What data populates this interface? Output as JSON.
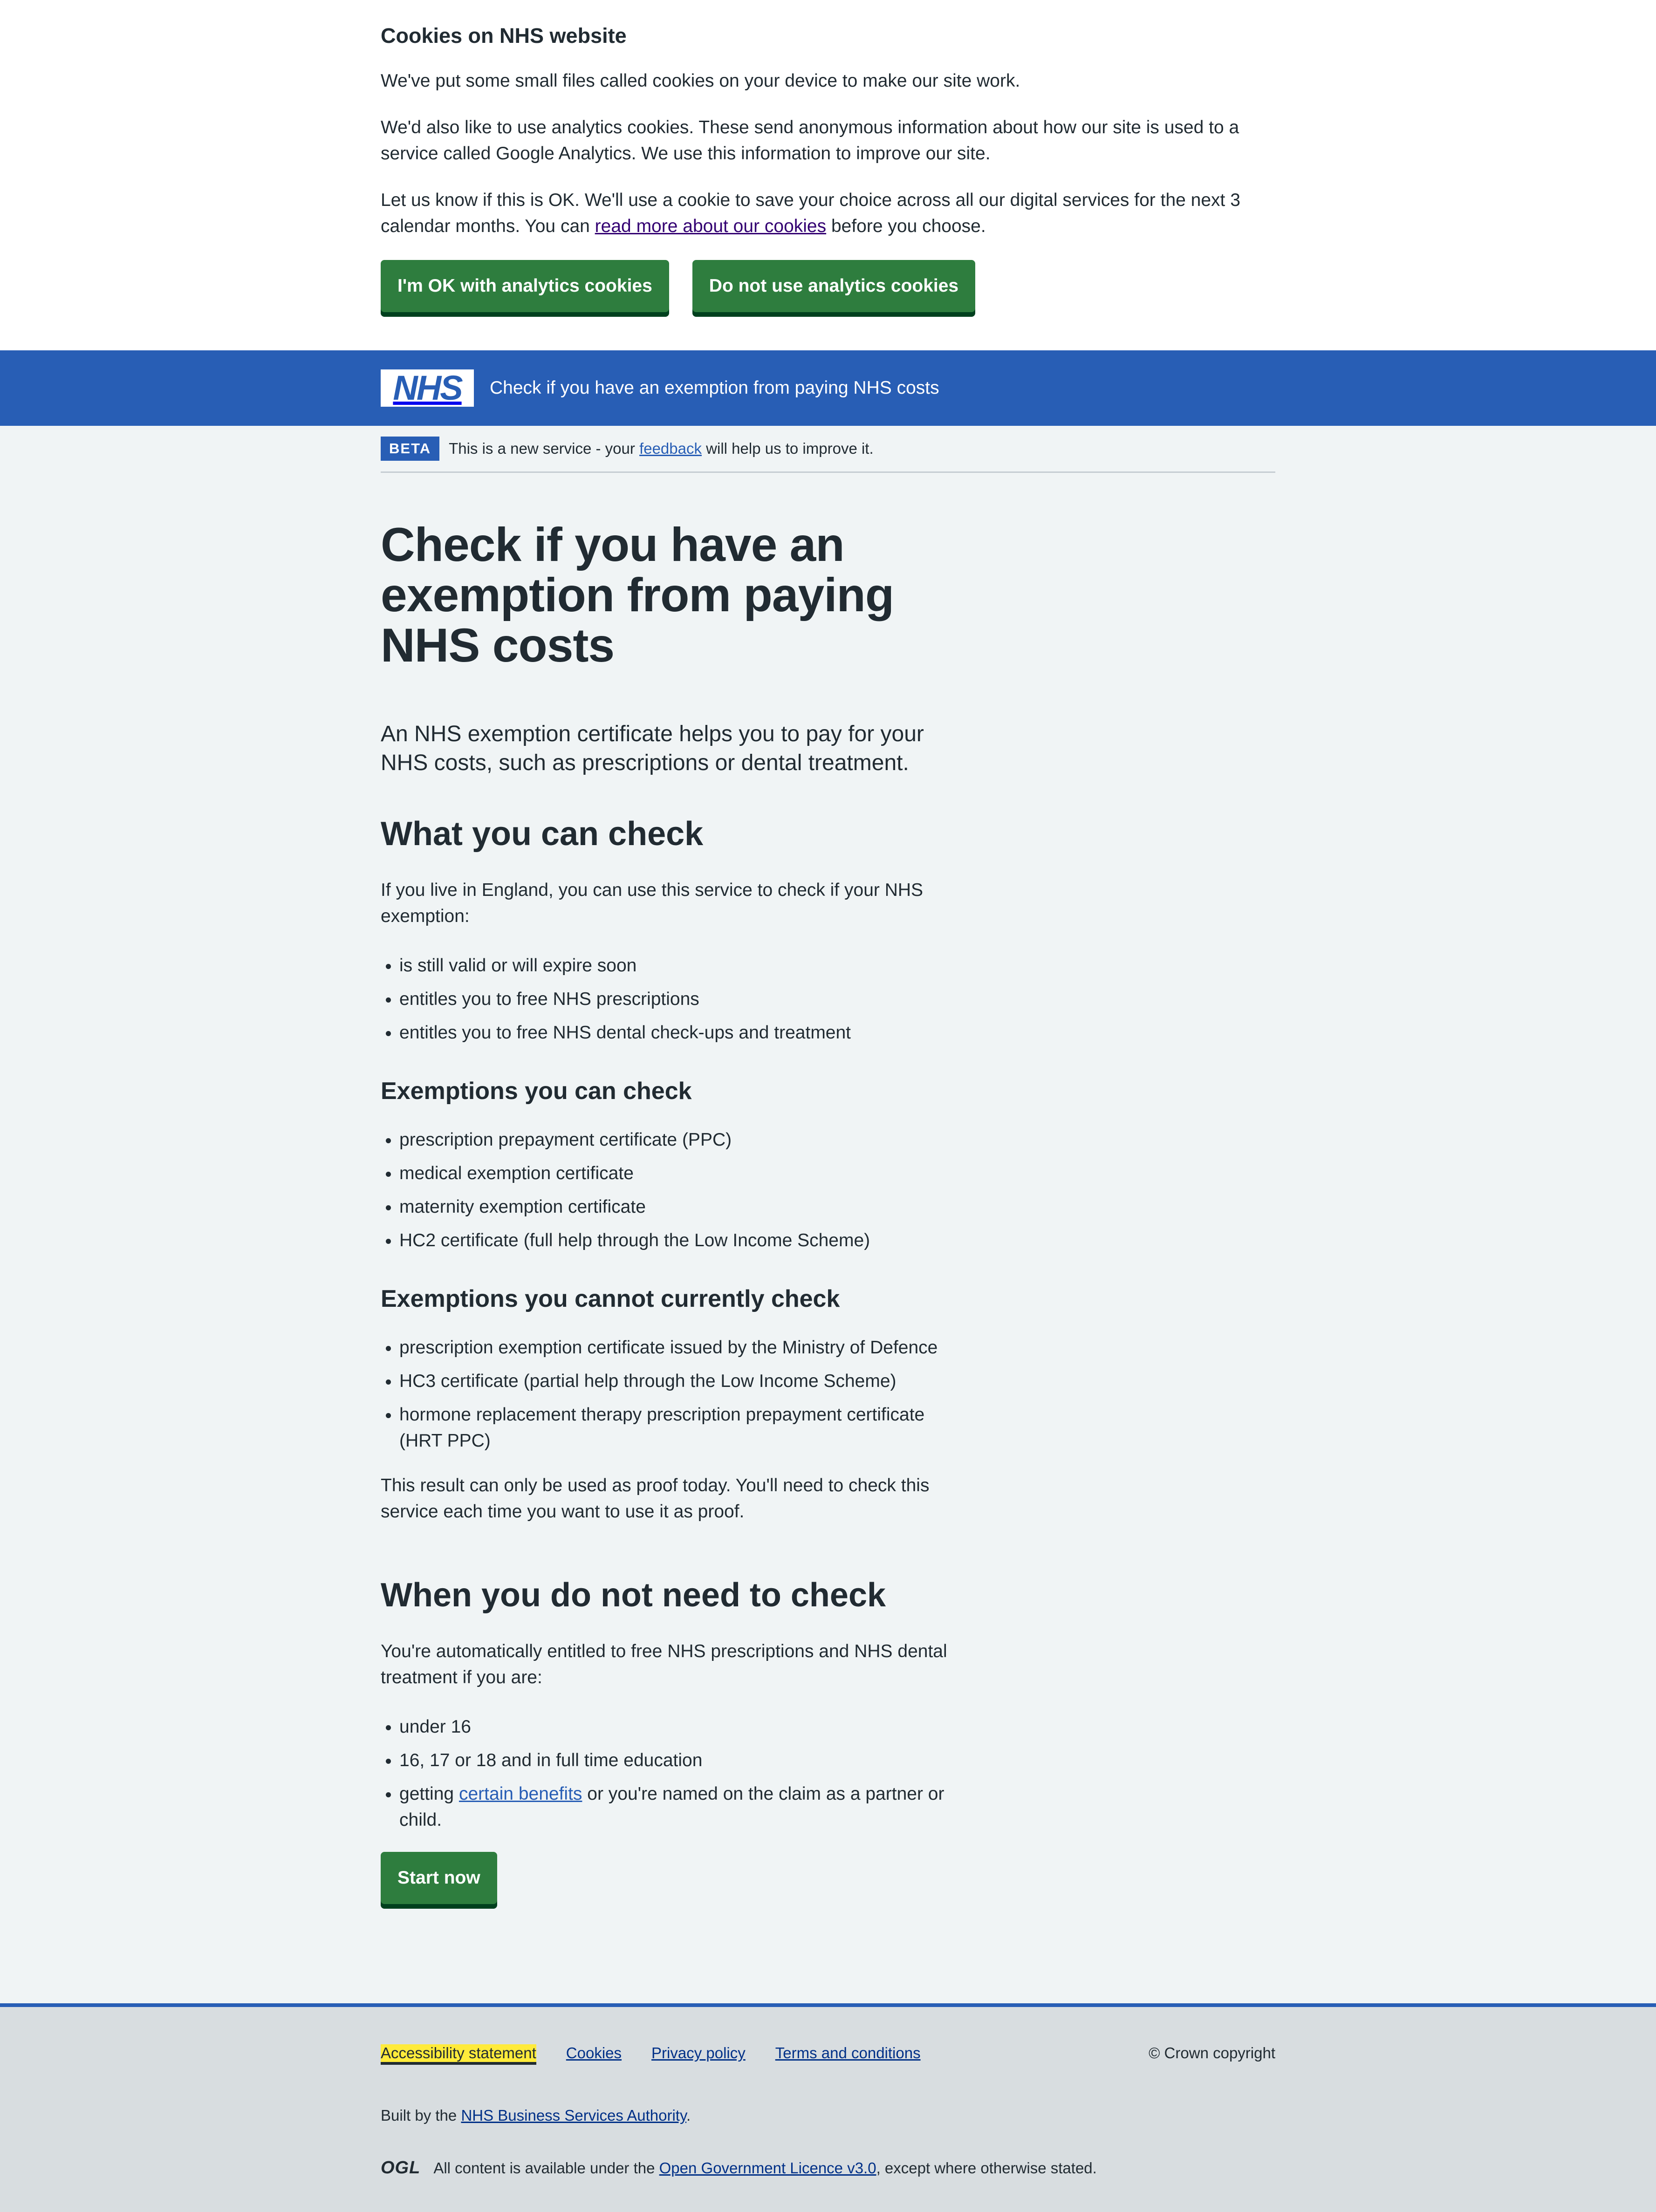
{
  "cookie_banner": {
    "title": "Cookies on NHS website",
    "p1": "We've put some small files called cookies on your device to make our site work.",
    "p2": "We'd also like to use analytics cookies. These send anonymous information about how our site is used to a service called Google Analytics. We use this information to improve our site.",
    "p3_before": "Let us know if this is OK. We'll use a cookie to save your choice across all our digital services for the next 3 calendar months. You can ",
    "p3_link": "read more about our cookies",
    "p3_after": " before you choose.",
    "accept_label": "I'm OK with analytics cookies",
    "reject_label": "Do not use analytics cookies"
  },
  "header": {
    "logo_text": "NHS",
    "service_name": "Check if you have an exemption from paying NHS costs"
  },
  "phase_banner": {
    "tag": "BETA",
    "text_before": "This is a new service - your ",
    "link": "feedback",
    "text_after": " will help us to improve it."
  },
  "main": {
    "title": "Check if you have an exemption from paying NHS costs",
    "lead": "An NHS exemption certificate helps you to pay for your NHS costs, such as prescriptions or dental treatment.",
    "what_heading": "What you can check",
    "what_intro": "If you live in England, you can use this service to check if your NHS exemption:",
    "what_items": [
      "is still valid or will expire soon",
      "entitles you to free NHS prescriptions",
      "entitles you to free NHS dental check-ups and treatment"
    ],
    "can_heading": "Exemptions you can check",
    "can_items": [
      "prescription prepayment certificate (PPC)",
      "medical exemption certificate",
      "maternity exemption certificate",
      "HC2 certificate (full help through the Low Income Scheme)"
    ],
    "cannot_heading": "Exemptions you cannot currently check",
    "cannot_items": [
      "prescription exemption certificate issued by the Ministry of Defence",
      "HC3 certificate (partial help through the Low Income Scheme)",
      "hormone replacement therapy prescription prepayment certificate (HRT PPC)"
    ],
    "proof_note": "This result can only be used as proof today. You'll need to check this service each time you want to use it as proof.",
    "when_heading": "When you do not need to check",
    "when_intro": "You're automatically entitled to free NHS prescriptions and NHS dental treatment if you are:",
    "when_items": [
      "under 16",
      "16, 17 or 18 and in full time education"
    ],
    "benefits_before": "getting ",
    "benefits_link": "certain benefits",
    "benefits_after": " or you're named on the claim as a partner or child.",
    "start_label": "Start now"
  },
  "footer": {
    "links": [
      "Accessibility statement",
      "Cookies",
      "Privacy policy",
      "Terms and conditions"
    ],
    "copyright": "© Crown copyright",
    "built_before": "Built by the ",
    "built_link": "NHS Business Services Authority",
    "built_after": ".",
    "ogl": "OGL",
    "licence_before": "All content is available under the ",
    "licence_link": "Open Government Licence v3.0",
    "licence_after": ", except where otherwise stated."
  }
}
